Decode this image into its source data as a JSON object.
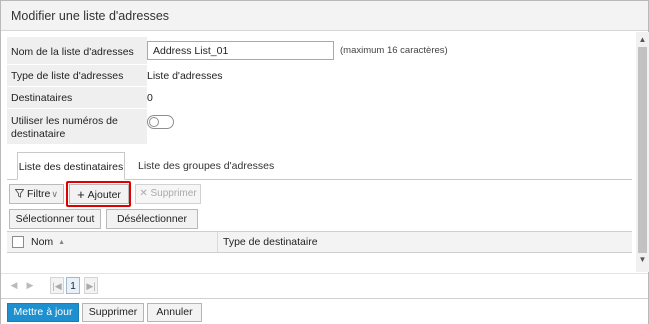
{
  "dialog": {
    "title": "Modifier une liste d'adresses"
  },
  "form": {
    "name_label": "Nom de la liste d'adresses",
    "name_value": "Address List_01",
    "name_hint": "(maximum 16 caractères)",
    "type_label": "Type de liste d'adresses",
    "type_value": "Liste d'adresses",
    "recipients_label": "Destinataires",
    "recipients_value": "0",
    "use_numbers_label_line1": "Utiliser les numéros de",
    "use_numbers_label_line2": "destinataire",
    "use_numbers_enabled": false
  },
  "tabs": [
    {
      "label": "Liste des destinataires",
      "active": true
    },
    {
      "label": "Liste des groupes d'adresses",
      "active": false
    }
  ],
  "toolbar": {
    "filter_label": "Filtre",
    "add_label": "Ajouter",
    "delete_label": "Supprimer",
    "select_all_label": "Sélectionner tout",
    "deselect_all_label": "Désélectionner tout"
  },
  "grid": {
    "columns": [
      {
        "label": "Nom",
        "sort": "ascending"
      },
      {
        "label": "Type de destinataire"
      }
    ],
    "rows": []
  },
  "pager": {
    "current_page": "1"
  },
  "footer": {
    "update_label": "Mettre à jour",
    "delete_label": "Supprimer",
    "cancel_label": "Annuler"
  },
  "colors": {
    "primary_button": "#1e90cf",
    "highlight": "#e00000"
  },
  "icons": {
    "filter": "filter-icon",
    "add": "plus-icon",
    "delete": "x-icon",
    "sort": "sort-up-icon"
  }
}
